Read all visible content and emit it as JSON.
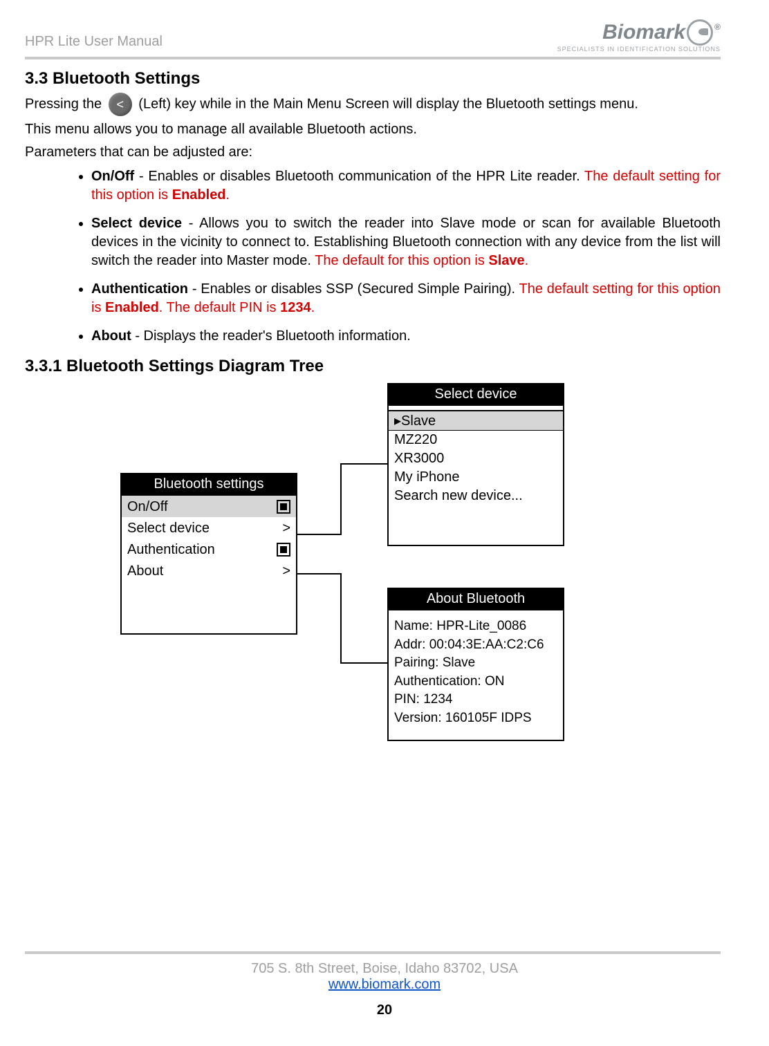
{
  "header": {
    "manual_title": "HPR Lite User Manual",
    "brand": "Biomark",
    "brand_tagline": "SPECIALISTS IN IDENTIFICATION SOLUTIONS",
    "reg": "®"
  },
  "section": {
    "number_title": "3.3  Bluetooth Settings",
    "intro_before_key": "Pressing the ",
    "left_key_glyph": "<",
    "intro_after_key": " (Left) key while in the Main Menu Screen will display the Bluetooth settings menu.",
    "line2": "This menu allows you to manage all available Bluetooth actions.",
    "line3": "Parameters that can be adjusted are:",
    "bullets": [
      {
        "label": "On/Off",
        "sep": " - ",
        "text": "Enables or disables Bluetooth communication of the HPR Lite reader. ",
        "red_prefix": "The default setting for this option is ",
        "red_bold": "Enabled",
        "red_suffix": "."
      },
      {
        "label": "Select device",
        "sep": " - ",
        "text": "Allows you to switch the reader into Slave mode or scan for available Bluetooth devices in the vicinity to connect to. Establishing Bluetooth connection with any device from the list will switch the reader into Master mode. ",
        "red_prefix": "The default for this option is ",
        "red_bold": "Slave",
        "red_suffix": "."
      },
      {
        "label": "Authentication",
        "sep": " - ",
        "text": "Enables or disables SSP (Secured Simple Pairing). ",
        "red_prefix": "The default setting for this option is ",
        "red_bold": "Enabled",
        "red_mid": ". The default PIN is ",
        "red_bold2": "1234",
        "red_suffix": "."
      },
      {
        "label": "About",
        "sep": " - ",
        "text": "Displays the reader's Bluetooth information.",
        "red_prefix": "",
        "red_bold": "",
        "red_suffix": ""
      }
    ],
    "sub_title": "3.3.1  Bluetooth Settings Diagram Tree"
  },
  "diagram": {
    "bluetooth_settings": {
      "title": "Bluetooth settings",
      "rows": [
        {
          "label": "On/Off",
          "sym": "checkbox",
          "selected": true
        },
        {
          "label": "Select device",
          "sym": ">",
          "selected": false
        },
        {
          "label": "Authentication",
          "sym": "checkbox",
          "selected": false
        },
        {
          "label": "About",
          "sym": ">",
          "selected": false
        }
      ]
    },
    "select_device": {
      "title": "Select device",
      "selected_marker": "▸",
      "selected": "Slave",
      "items": [
        "MZ220",
        "XR3000",
        "My iPhone",
        "Search new device..."
      ]
    },
    "about_bluetooth": {
      "title": "About Bluetooth",
      "lines": [
        "Name: HPR-Lite_0086",
        "Addr: 00:04:3E:AA:C2:C6",
        "Pairing: Slave",
        "Authentication: ON",
        "PIN: 1234",
        "Version: 160105F IDPS"
      ]
    }
  },
  "footer": {
    "address": "705 S. 8th Street, Boise, Idaho 83702, USA",
    "url": "www.biomark.com",
    "page": "20"
  }
}
